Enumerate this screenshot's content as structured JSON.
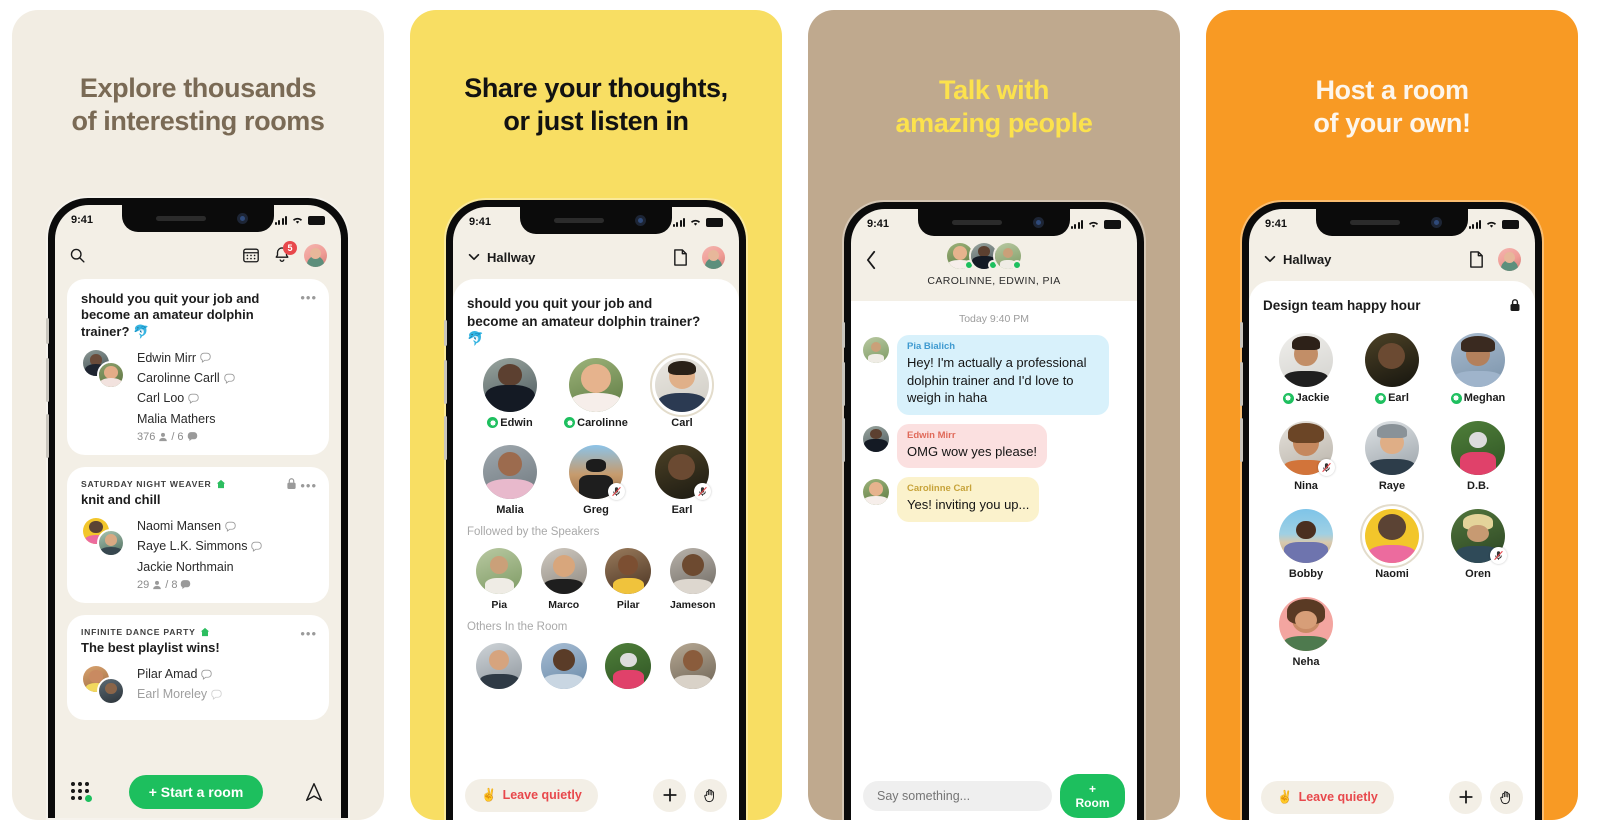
{
  "meta": {
    "app": "Clubhouse",
    "status_time": "9:41"
  },
  "panels": [
    {
      "id": "explore",
      "bg": "#F2EDE3",
      "title_color": "#7A6A55",
      "title": "Explore thousands\nof interesting rooms",
      "screen_type": "hallway-feed",
      "nav": {
        "search_icon": "search-icon",
        "calendar_icon": "calendar-icon",
        "bell_icon": "bell-icon",
        "bell_badge": "5",
        "avatar": "user-avatar"
      },
      "cards": [
        {
          "club": "",
          "title": "should you quit your job and become an amateur dolphin trainer? 🐬",
          "locked": false,
          "speakers": [
            "Edwin Mirr",
            "Carolinne Carll",
            "Carl Loo",
            "Malia Mathers"
          ],
          "chat_flags": [
            true,
            true,
            true,
            false
          ],
          "listeners": "376",
          "comments": "6"
        },
        {
          "club": "SATURDAY NIGHT WEAVER",
          "title": "knit and chill",
          "locked": true,
          "speakers": [
            "Naomi Mansen",
            "Raye L.K. Simmons",
            "Jackie Northmain"
          ],
          "chat_flags": [
            true,
            true,
            false
          ],
          "listeners": "29",
          "comments": "8"
        },
        {
          "club": "INFINITE DANCE PARTY",
          "title": "The best playlist wins!",
          "locked": false,
          "speakers": [
            "Pilar Amad",
            "Earl Moreley"
          ],
          "chat_flags": [
            true,
            true
          ],
          "listeners": "",
          "comments": ""
        }
      ],
      "bottom": {
        "start_room_label": "+ Start a room",
        "grid_icon": "grid-dots-icon",
        "paper_plane_icon": "paper-plane-icon"
      }
    },
    {
      "id": "room-listen",
      "bg": "#F8DE63",
      "title_color": "#121212",
      "title": "Share your thoughts,\nor just listen in",
      "screen_type": "room",
      "nav": {
        "hallway_label": "Hallway",
        "chevron_icon": "chevron-down-icon",
        "doc_icon": "document-icon",
        "avatar": "user-avatar"
      },
      "room": {
        "heading": "should you quit your job and become an amateur dolphin trainer? 🐬",
        "locked": false,
        "speakers": [
          {
            "name": "Edwin",
            "host": true,
            "muted": false,
            "speaking": false
          },
          {
            "name": "Carolinne",
            "host": true,
            "muted": false,
            "speaking": false
          },
          {
            "name": "Carl",
            "host": false,
            "muted": false,
            "speaking": true
          },
          {
            "name": "Malia",
            "host": false,
            "muted": false,
            "speaking": false
          },
          {
            "name": "Greg",
            "host": false,
            "muted": true,
            "speaking": false
          },
          {
            "name": "Earl",
            "host": false,
            "muted": true,
            "speaking": false
          }
        ],
        "followed_label": "Followed by the Speakers",
        "followed": [
          {
            "name": "Pia"
          },
          {
            "name": "Marco"
          },
          {
            "name": "Pilar"
          },
          {
            "name": "Jameson"
          }
        ],
        "others_label": "Others In the Room",
        "others": [
          {
            "name": ""
          },
          {
            "name": ""
          },
          {
            "name": ""
          },
          {
            "name": ""
          }
        ]
      },
      "bottom": {
        "leave_label": "Leave quietly",
        "leave_emoji": "✌️",
        "plus_icon": "plus-icon",
        "hand_icon": "raise-hand-icon"
      }
    },
    {
      "id": "chat",
      "bg": "#BFA98E",
      "title_color": "#FCE24D",
      "title": "Talk with\namazing people",
      "screen_type": "chat",
      "header": {
        "back_icon": "back-chevron-icon",
        "participants": [
          "Carolinne",
          "Edwin",
          "Pia"
        ],
        "title": "CAROLINNE, EDWIN, PIA"
      },
      "chat": {
        "timestamp": "Today 9:40 PM",
        "messages": [
          {
            "sender": "Pia Bialich",
            "sender_color": "#3F9AD0",
            "bubble_color": "#D8F1FB",
            "text": "Hey! I'm actually a professional dolphin trainer and I'd love to weigh in haha"
          },
          {
            "sender": "Edwin Mirr",
            "sender_color": "#E06A5A",
            "bubble_color": "#FBE0E0",
            "text": "OMG wow yes please!"
          },
          {
            "sender": "Carolinne Carl",
            "sender_color": "#C7A33A",
            "bubble_color": "#FBF2CC",
            "text": "Yes! inviting you up..."
          }
        ]
      },
      "bottom": {
        "input_placeholder": "Say something...",
        "room_button_label": "+ Room"
      }
    },
    {
      "id": "host-room",
      "bg": "#F89A24",
      "title_color": "#FDF6EC",
      "title": "Host a room\nof your own!",
      "screen_type": "room",
      "nav": {
        "hallway_label": "Hallway",
        "chevron_icon": "chevron-down-icon",
        "doc_icon": "document-icon",
        "avatar": "user-avatar"
      },
      "room": {
        "heading": "Design team happy hour",
        "locked": true,
        "speakers": [
          {
            "name": "Jackie",
            "host": true,
            "muted": false,
            "speaking": false
          },
          {
            "name": "Earl",
            "host": true,
            "muted": false,
            "speaking": false
          },
          {
            "name": "Meghan",
            "host": true,
            "muted": false,
            "speaking": false
          },
          {
            "name": "Nina",
            "host": false,
            "muted": true,
            "speaking": false
          },
          {
            "name": "Raye",
            "host": false,
            "muted": false,
            "speaking": false
          },
          {
            "name": "D.B.",
            "host": false,
            "muted": false,
            "speaking": false
          },
          {
            "name": "Bobby",
            "host": false,
            "muted": false,
            "speaking": false
          },
          {
            "name": "Naomi",
            "host": false,
            "muted": false,
            "speaking": true
          },
          {
            "name": "Oren",
            "host": false,
            "muted": true,
            "speaking": false
          },
          {
            "name": "Neha",
            "host": false,
            "muted": false,
            "speaking": false
          }
        ]
      },
      "bottom": {
        "leave_label": "Leave quietly",
        "leave_emoji": "✌️",
        "plus_icon": "plus-icon",
        "hand_icon": "raise-hand-icon"
      }
    }
  ]
}
